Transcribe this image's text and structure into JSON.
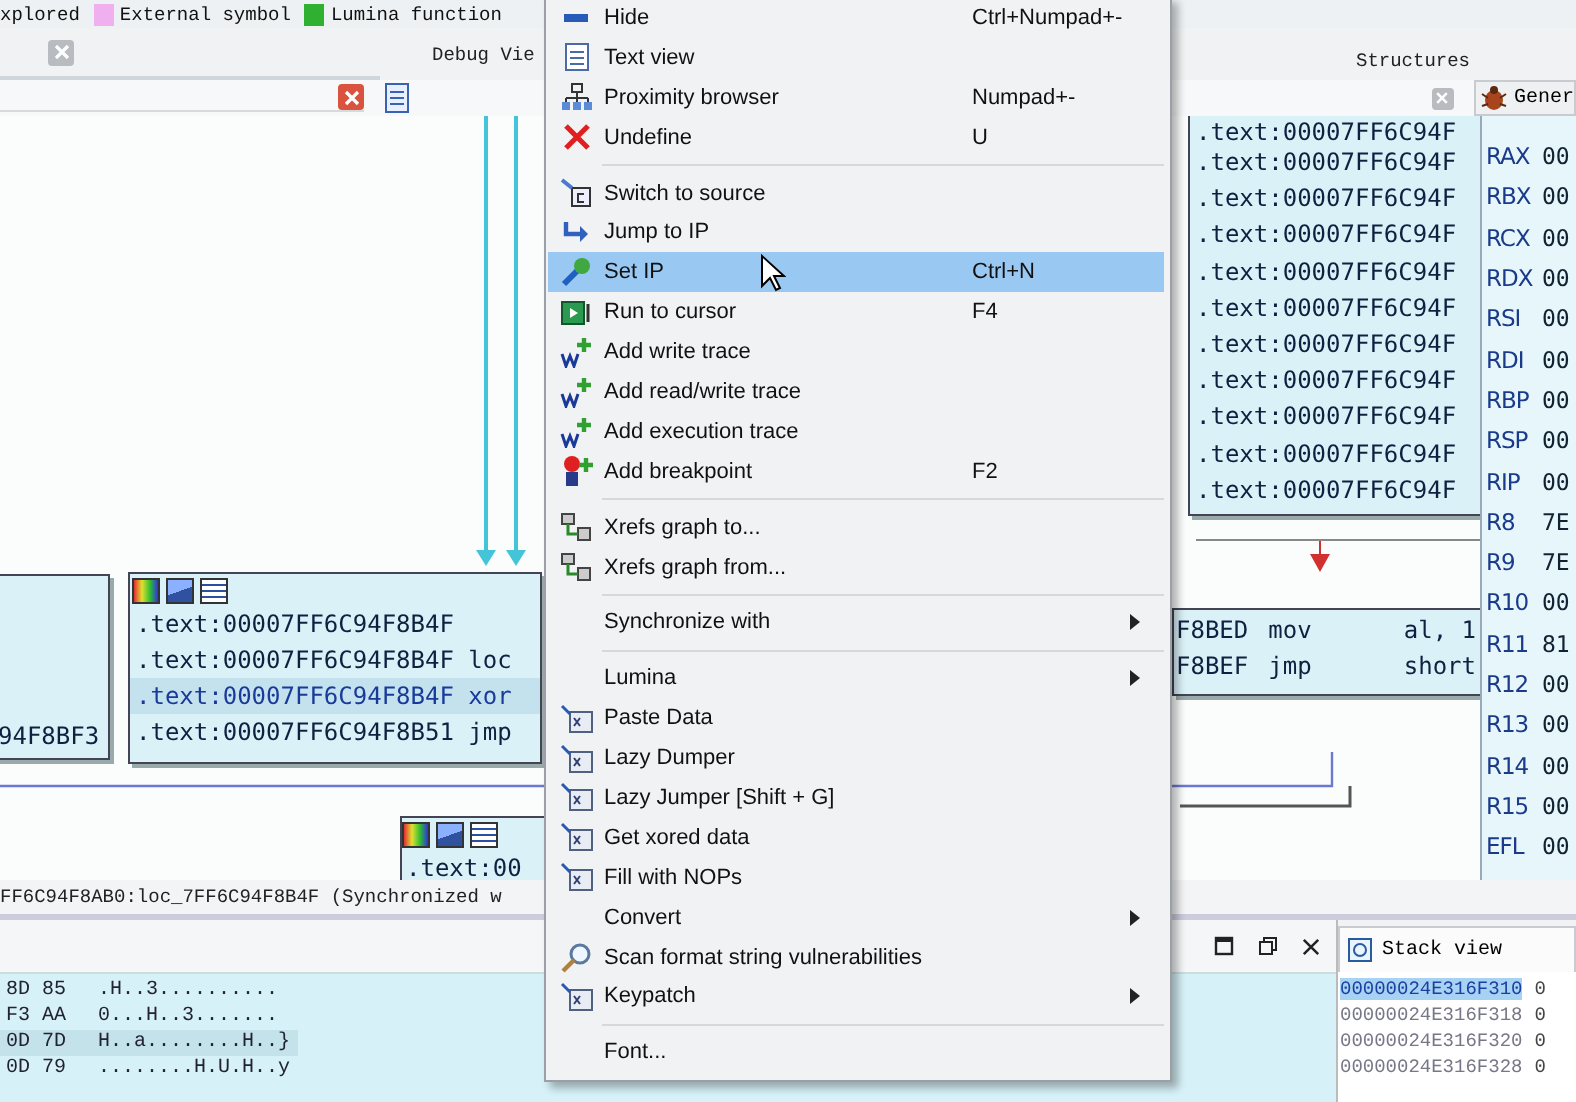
{
  "legend": {
    "cut_label": "xplored",
    "items": [
      {
        "label": "External symbol",
        "color": "#f0b0f0"
      },
      {
        "label": "Lumina function",
        "color": "#30b030"
      }
    ]
  },
  "tabs": [
    {
      "label": "Debug Vie"
    },
    {
      "label": "Structures"
    }
  ],
  "general_tab": {
    "label": "Gener"
  },
  "graph": {
    "right_node": {
      "lines": [
        ".text:00007FF6C94F",
        ".text:00007FF6C94F",
        ".text:00007FF6C94F",
        ".text:00007FF6C94F",
        ".text:00007FF6C94F",
        ".text:00007FF6C94F",
        ".text:00007FF6C94F",
        ".text:00007FF6C94F",
        ".text:00007FF6C94F",
        ".text:00007FF6C94F",
        ".text:00007FF6C94F"
      ]
    },
    "left_node": {
      "lines": [
        "94F8BF3"
      ]
    },
    "middle_node": {
      "lines": [
        {
          "text": ".text:00007FF6C94F8B4F",
          "selected": false
        },
        {
          "text": ".text:00007FF6C94F8B4F loc",
          "selected": false
        },
        {
          "text": ".text:00007FF6C94F8B4F xor",
          "selected": true
        },
        {
          "text": ".text:00007FF6C94F8B51 jmp",
          "selected": false
        }
      ]
    },
    "branch_node": {
      "lines": [
        {
          "address": "F8BED",
          "mnemonic": "mov",
          "operands": "al, 1"
        },
        {
          "address": "F8BEF",
          "mnemonic": "jmp",
          "operands": "short"
        }
      ]
    },
    "small_node": {
      "lines": [
        ".text:00"
      ]
    }
  },
  "registers": [
    {
      "name": "RAX",
      "value": "00"
    },
    {
      "name": "RBX",
      "value": "00"
    },
    {
      "name": "RCX",
      "value": "00"
    },
    {
      "name": "RDX",
      "value": "00"
    },
    {
      "name": "RSI",
      "value": "00"
    },
    {
      "name": "RDI",
      "value": "00"
    },
    {
      "name": "RBP",
      "value": "00"
    },
    {
      "name": "RSP",
      "value": "00"
    },
    {
      "name": "RIP",
      "value": "00"
    },
    {
      "name": "R8",
      "value": "7E"
    },
    {
      "name": "R9",
      "value": "7E"
    },
    {
      "name": "R10",
      "value": "00"
    },
    {
      "name": "R11",
      "value": "81"
    },
    {
      "name": "R12",
      "value": "00"
    },
    {
      "name": "R13",
      "value": "00"
    },
    {
      "name": "R14",
      "value": "00"
    },
    {
      "name": "R15",
      "value": "00"
    },
    {
      "name": "EFL",
      "value": "00"
    }
  ],
  "status_line": "FF6C94F8AB0:loc_7FF6C94F8B4F (Synchronized w",
  "hex_view": {
    "rows": [
      {
        "bytes": "8D 85",
        "ascii": ".H..3..........",
        "selected": false
      },
      {
        "bytes": "F3 AA",
        "ascii": "0...H..3.......",
        "selected": false
      },
      {
        "bytes": "0D 7D",
        "ascii": "H..a........H..}",
        "selected": true
      },
      {
        "bytes": "0D 79",
        "ascii": "........H.U.H..y",
        "selected": false
      }
    ]
  },
  "stack_view": {
    "title": "Stack view",
    "rows": [
      {
        "address": "00000024E316F310",
        "value": "0",
        "selected": true
      },
      {
        "address": "00000024E316F318",
        "value": "0",
        "selected": false
      },
      {
        "address": "00000024E316F320",
        "value": "0",
        "selected": false
      },
      {
        "address": "00000024E316F328",
        "value": "0",
        "selected": false
      }
    ]
  },
  "context_menu": {
    "items": [
      {
        "kind": "item",
        "label": "Hide",
        "shortcut": "Ctrl+Numpad+-",
        "selected": false
      },
      {
        "kind": "item",
        "label": "Text view",
        "selected": false
      },
      {
        "kind": "item",
        "label": "Proximity browser",
        "shortcut": "Numpad+-",
        "selected": false
      },
      {
        "kind": "item",
        "label": "Undefine",
        "shortcut": "U",
        "selected": false
      },
      {
        "kind": "separator"
      },
      {
        "kind": "item",
        "label": "Switch to source",
        "selected": false
      },
      {
        "kind": "item",
        "label": "Jump to IP",
        "selected": false
      },
      {
        "kind": "item",
        "label": "Set IP",
        "shortcut": "Ctrl+N",
        "selected": true
      },
      {
        "kind": "item",
        "label": "Run to cursor",
        "shortcut": "F4",
        "selected": false
      },
      {
        "kind": "item",
        "label": "Add write trace",
        "selected": false
      },
      {
        "kind": "item",
        "label": "Add read/write trace",
        "selected": false
      },
      {
        "kind": "item",
        "label": "Add execution trace",
        "selected": false
      },
      {
        "kind": "item",
        "label": "Add breakpoint",
        "shortcut": "F2",
        "selected": false
      },
      {
        "kind": "separator"
      },
      {
        "kind": "item",
        "label": "Xrefs graph to...",
        "selected": false
      },
      {
        "kind": "item",
        "label": "Xrefs graph from...",
        "selected": false
      },
      {
        "kind": "separator"
      },
      {
        "kind": "submenu",
        "label": "Synchronize with",
        "selected": false
      },
      {
        "kind": "separator"
      },
      {
        "kind": "submenu",
        "label": "Lumina",
        "selected": false
      },
      {
        "kind": "item",
        "label": "Paste Data",
        "selected": false
      },
      {
        "kind": "item",
        "label": "Lazy Dumper",
        "selected": false
      },
      {
        "kind": "item",
        "label": "Lazy Jumper [Shift + G]",
        "selected": false
      },
      {
        "kind": "item",
        "label": "Get xored data",
        "selected": false
      },
      {
        "kind": "item",
        "label": "Fill with NOPs",
        "selected": false
      },
      {
        "kind": "submenu",
        "label": "Convert",
        "selected": false
      },
      {
        "kind": "item",
        "label": "Scan format string vulnerabilities",
        "selected": false
      },
      {
        "kind": "submenu",
        "label": "Keypatch",
        "selected": false
      },
      {
        "kind": "separator"
      },
      {
        "kind": "item",
        "label": "Font...",
        "selected": false
      }
    ]
  }
}
